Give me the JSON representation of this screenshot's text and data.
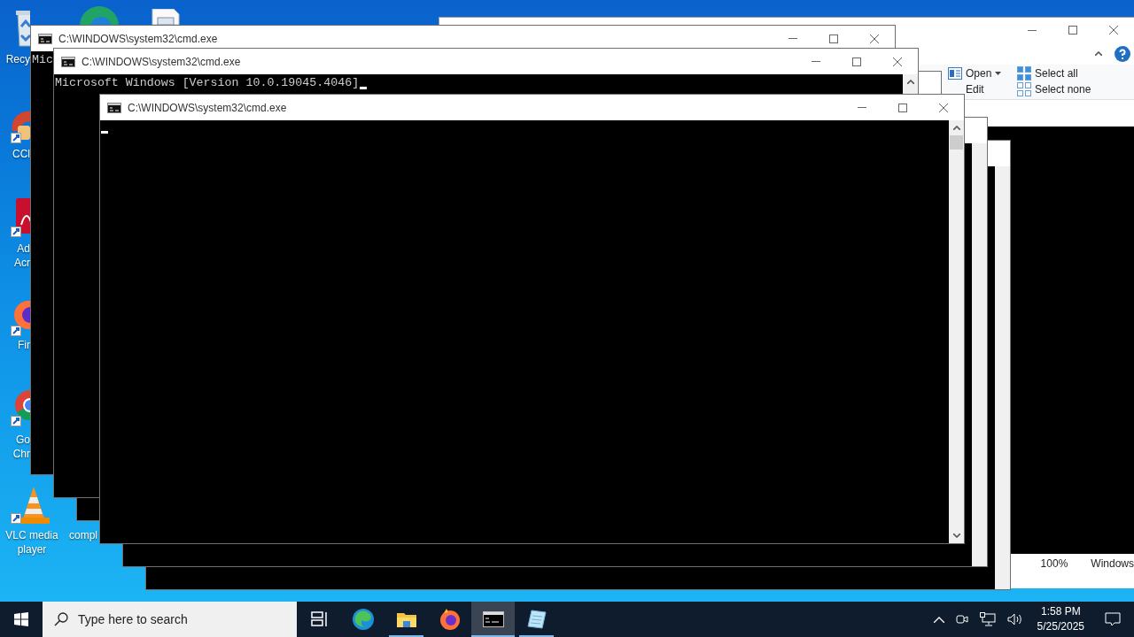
{
  "desktop_icons": [
    {
      "lines": [
        "Recy"
      ]
    },
    {
      "lines": [
        "CCl"
      ]
    },
    {
      "lines": [
        "Ad",
        "Acr"
      ]
    },
    {
      "lines": [
        "Fir"
      ]
    },
    {
      "lines": [
        "Go",
        "Chr"
      ]
    },
    {
      "lines": [
        "VLC media",
        "player"
      ]
    },
    {
      "lines": [
        "compl"
      ]
    }
  ],
  "explorer": {
    "ribbon": [
      {
        "label": "Open",
        "caret": true
      },
      {
        "label": "Select all",
        "caret": false
      },
      {
        "label": "Edit",
        "caret": false
      },
      {
        "label": "Select none",
        "caret": false
      }
    ],
    "status": [
      "100%",
      "Windows"
    ]
  },
  "console_windows": [
    {
      "kind": "console",
      "title": "C:\\WINDOWS\\system32\\cmd.exe",
      "lines": [
        "Mic"
      ]
    },
    {
      "kind": "frame"
    },
    {
      "kind": "console",
      "title": "C:\\WINDOWS\\system32\\cmd.exe",
      "lines": [
        "Microsoft Windows [Version 10.0.19045.4046]"
      ],
      "cursor": true
    },
    {
      "kind": "frame"
    },
    {
      "kind": "frame"
    },
    {
      "kind": "console",
      "title": "C:\\WINDOWS\\system32\\cmd.exe",
      "cursor": true
    }
  ],
  "taskbar": {
    "search": {
      "placeholder": "Type here to search"
    },
    "apps": [
      {
        "selected": false,
        "running": false
      },
      {
        "selected": false,
        "running": false
      },
      {
        "selected": false,
        "running": true
      },
      {
        "selected": false,
        "running": false
      },
      {
        "selected": true,
        "running": true
      },
      {
        "selected": false,
        "running": true
      }
    ],
    "clock": {
      "time": "1:58 PM",
      "date": "5/25/2025"
    }
  }
}
